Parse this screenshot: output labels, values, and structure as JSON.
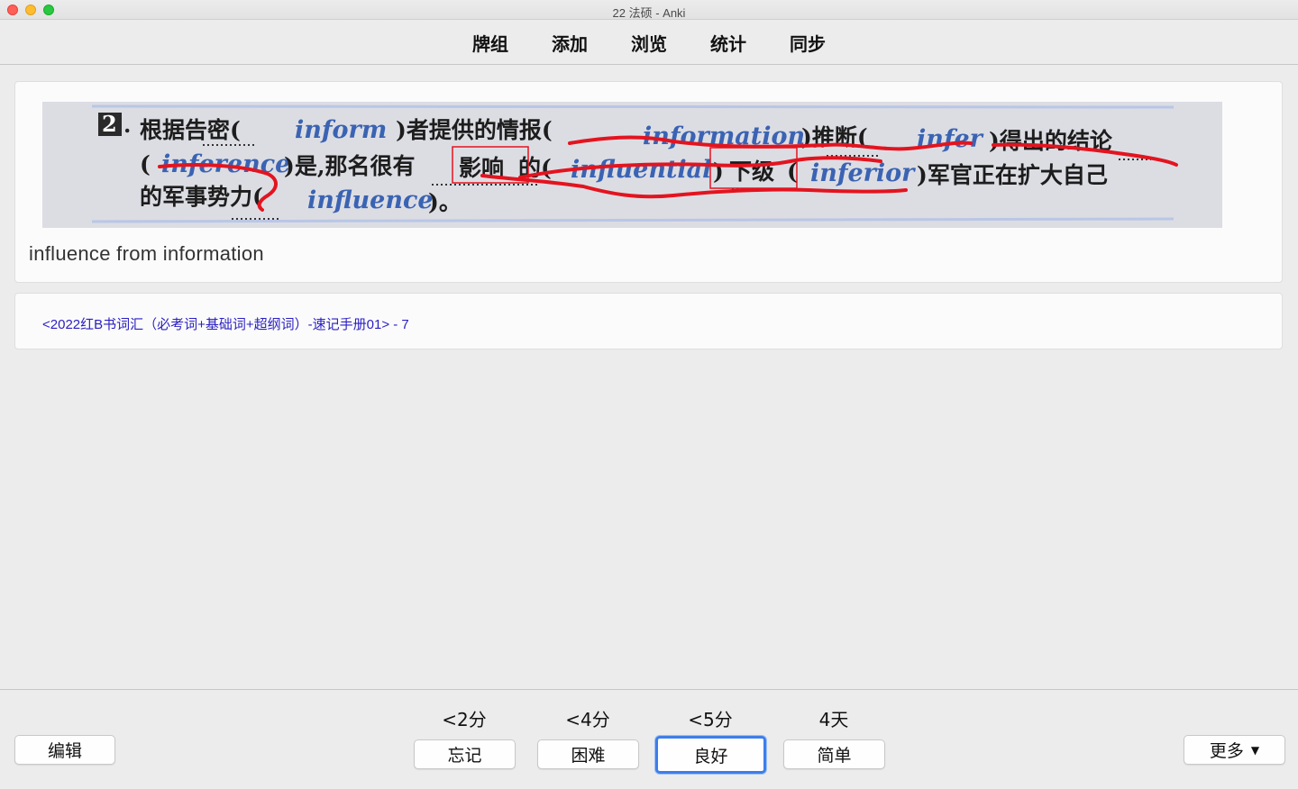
{
  "window": {
    "title": "22 法硕 - Anki"
  },
  "toolbar": {
    "items": [
      "牌组",
      "添加",
      "浏览",
      "统计",
      "同步"
    ]
  },
  "card": {
    "image": {
      "number": "2",
      "line1": {
        "t1": "根据告密(",
        "w1": "inform",
        "t2": ")者提供的情报(",
        "w2": "information",
        "t3": ")推断(",
        "w3": "infer",
        "t4": ")得出的结论"
      },
      "line2": {
        "t1": "(",
        "w1": "inference",
        "t2": ")是,那名很有",
        "t3": "影响",
        "t4": "的(",
        "w2": "influential",
        "t5": ")",
        "t6": "下级",
        "t7": "(",
        "w3": "inferior",
        "t8": ")军官正在扩大自己"
      },
      "line3": {
        "t1": "的军事势力(",
        "w1": "influence",
        "t2": ")。"
      }
    },
    "text": "influence from information",
    "source": "<2022红B书词汇（必考词+基础词+超纲词）-速记手册01> - 7"
  },
  "bottom": {
    "edit_label": "编辑",
    "more_label": "更多",
    "answers": [
      {
        "interval": "<2分",
        "label": "忘记"
      },
      {
        "interval": "<4分",
        "label": "困难"
      },
      {
        "interval": "<5分",
        "label": "良好"
      },
      {
        "interval": "4天",
        "label": "简单"
      }
    ]
  }
}
